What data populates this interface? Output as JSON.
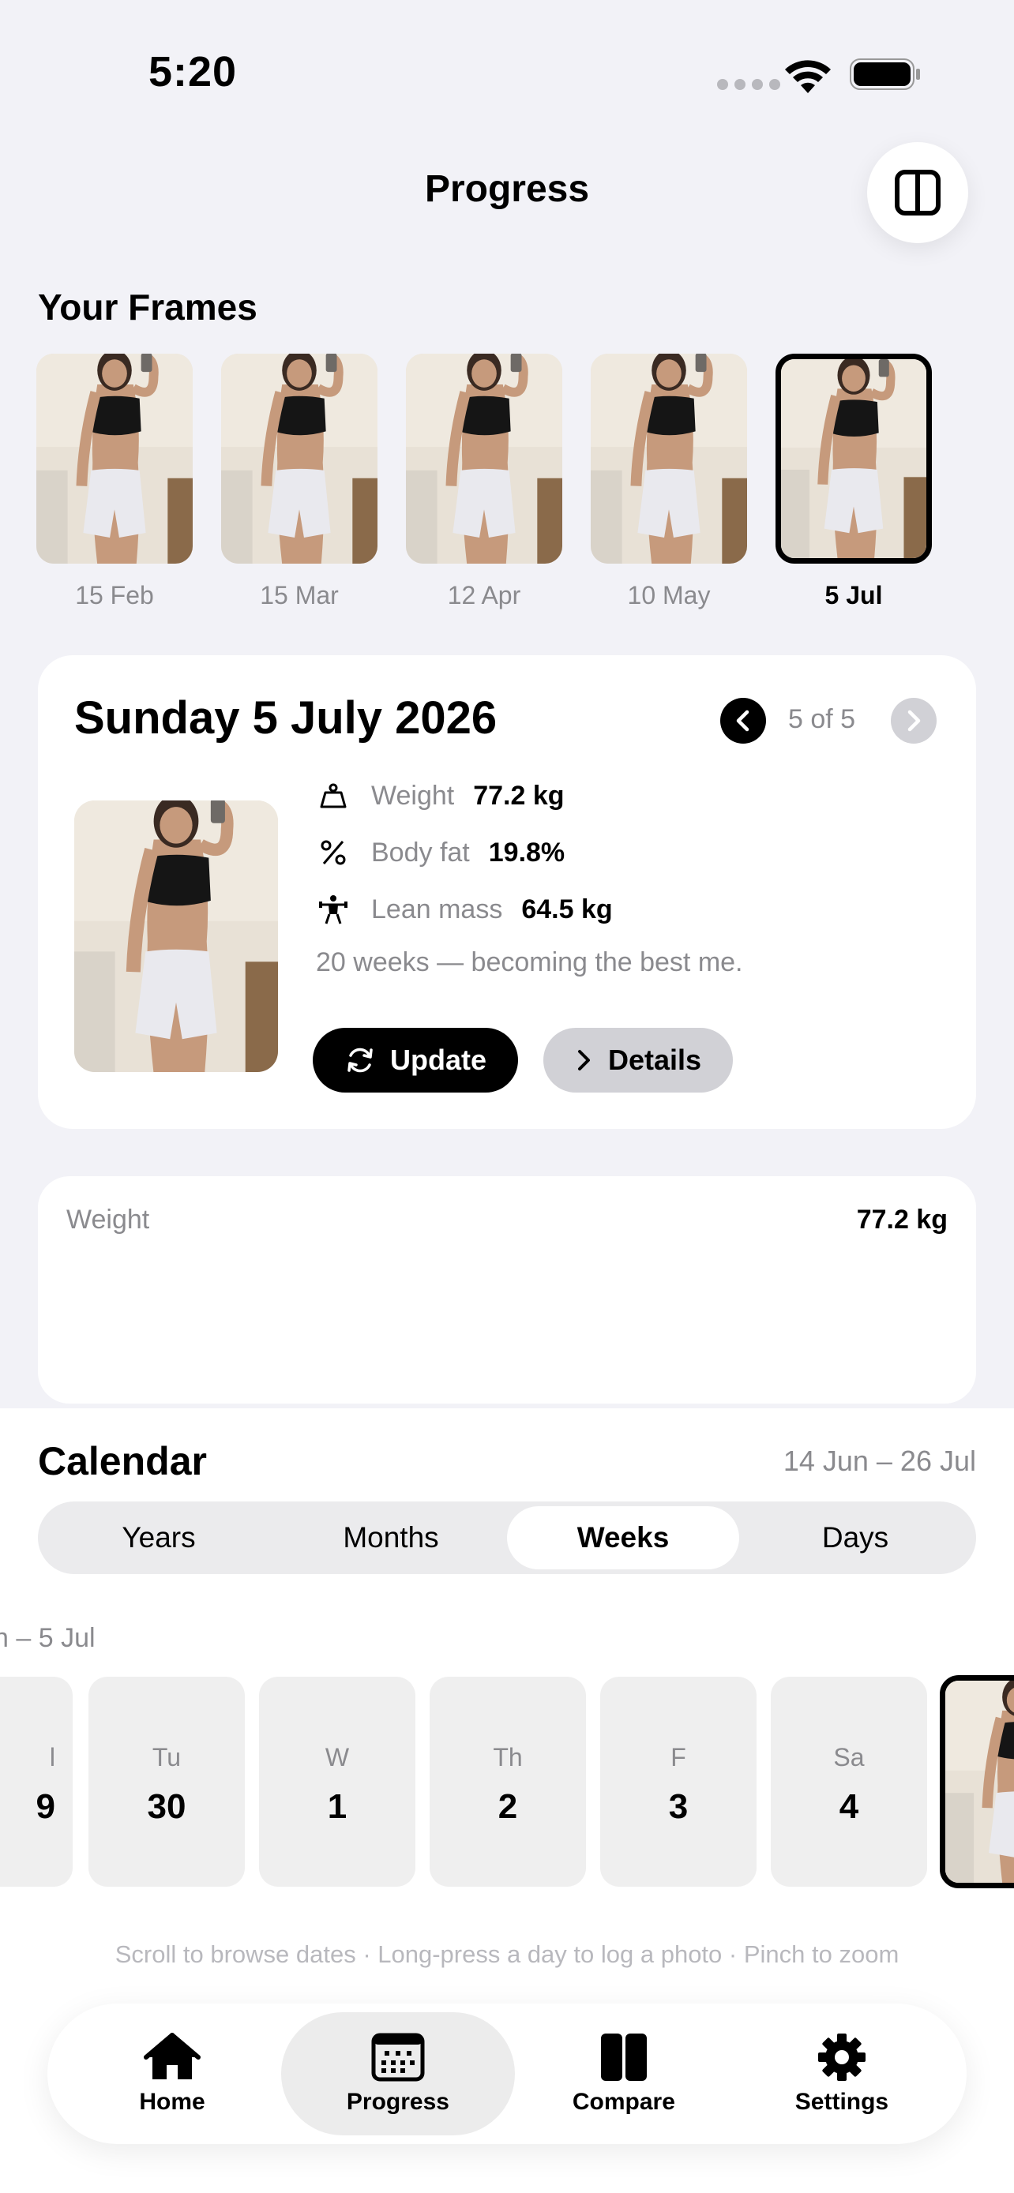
{
  "status_bar": {
    "time": "5:20"
  },
  "header": {
    "title": "Progress"
  },
  "frames": {
    "heading": "Your Frames",
    "items": [
      {
        "label": "15 Feb",
        "selected": false
      },
      {
        "label": "15 Mar",
        "selected": false
      },
      {
        "label": "12 Apr",
        "selected": false
      },
      {
        "label": "10 May",
        "selected": false
      },
      {
        "label": "5 Jul",
        "selected": true
      }
    ]
  },
  "detail": {
    "date": "Sunday 5 July 2026",
    "counter": "5 of 5",
    "metrics": [
      {
        "icon": "weight-icon",
        "label": "Weight",
        "value": "77.2 kg"
      },
      {
        "icon": "percent-icon",
        "label": "Body fat",
        "value": "19.8%"
      },
      {
        "icon": "lifter-icon",
        "label": "Lean mass",
        "value": "64.5 kg"
      }
    ],
    "note": "20 weeks — becoming the best me.",
    "update_label": "Update",
    "details_label": "Details"
  },
  "weight_card": {
    "label": "Weight",
    "value": "77.2 kg"
  },
  "calendar": {
    "title": "Calendar",
    "range": "14 Jun – 26 Jul",
    "segments": [
      "Years",
      "Months",
      "Weeks",
      "Days"
    ],
    "active_segment": "Weeks",
    "week_label": "n – 5 Jul",
    "days": [
      {
        "name": "l",
        "num": "9"
      },
      {
        "name": "Tu",
        "num": "30"
      },
      {
        "name": "W",
        "num": "1"
      },
      {
        "name": "Th",
        "num": "2"
      },
      {
        "name": "F",
        "num": "3"
      },
      {
        "name": "Sa",
        "num": "4"
      }
    ],
    "hint": "Scroll to browse dates · Long-press a day to log a photo · Pinch to zoom"
  },
  "tabs": [
    {
      "label": "Home",
      "icon": "home-icon"
    },
    {
      "label": "Progress",
      "icon": "calendar-icon",
      "active": true
    },
    {
      "label": "Compare",
      "icon": "compare-icon"
    },
    {
      "label": "Settings",
      "icon": "gear-icon"
    }
  ],
  "colors": {
    "accent": "#000000",
    "background": "#f2f2f7",
    "secondary_text": "#8a8a8e",
    "chip": "#d1d1d6"
  }
}
